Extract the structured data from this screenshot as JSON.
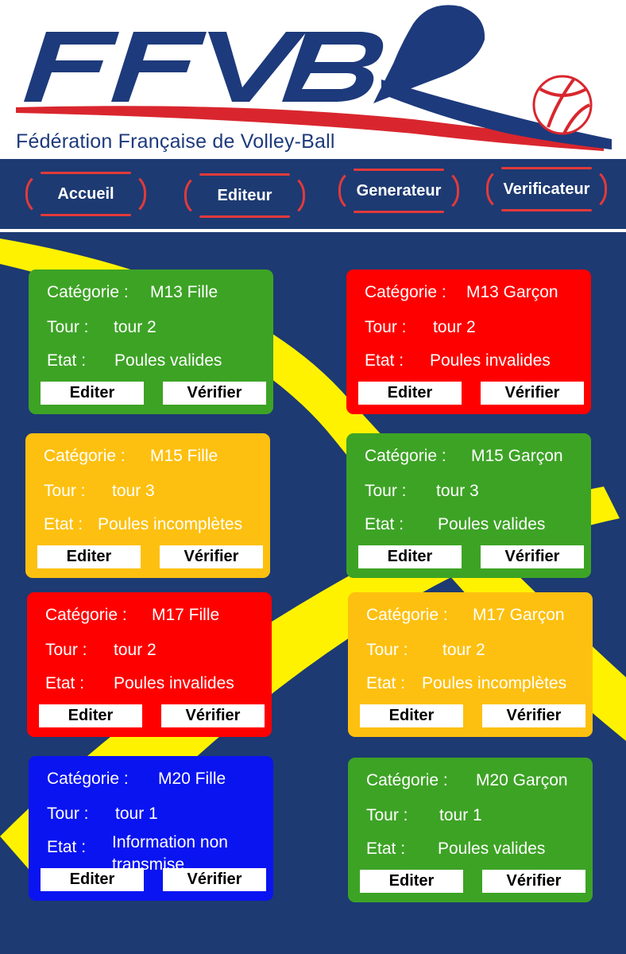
{
  "brand": {
    "logo_text": "FFVB",
    "federation_name": "Fédération Française de Volley-Ball",
    "colors": {
      "navy": "#1d3a7c",
      "red": "#d9262e",
      "white": "#ffffff"
    }
  },
  "nav": {
    "items": [
      {
        "label": "Accueil"
      },
      {
        "label": "Editeur"
      },
      {
        "label": "Generateur"
      },
      {
        "label": "Verificateur"
      }
    ],
    "border_color": "#e23a3a",
    "background": "#1d3a72"
  },
  "labels": {
    "categorie": "Catégorie :",
    "tour": "Tour :",
    "etat": "Etat :",
    "edit": "Editer",
    "verify": "Vérifier"
  },
  "status_colors": {
    "Poules valides": "#3da325",
    "Poules invalides": "#ff0000",
    "Poules incomplètes": "#fdc010",
    "Information non transmise": "#0a14f0"
  },
  "cards": [
    {
      "categorie": "M13 Fille",
      "tour": "tour 2",
      "etat": "Poules valides"
    },
    {
      "categorie": "M13 Garçon",
      "tour": "tour 2",
      "etat": "Poules invalides"
    },
    {
      "categorie": "M15 Fille",
      "tour": "tour 3",
      "etat": "Poules incomplètes"
    },
    {
      "categorie": "M15 Garçon",
      "tour": "tour 3",
      "etat": "Poules valides"
    },
    {
      "categorie": "M17 Fille",
      "tour": "tour 2",
      "etat": "Poules invalides"
    },
    {
      "categorie": "M17 Garçon",
      "tour": "tour 2",
      "etat": "Poules incomplètes"
    },
    {
      "categorie": "M20 Fille",
      "tour": "tour 1",
      "etat": "Information non transmise"
    },
    {
      "categorie": "M20 Garçon",
      "tour": "tour 1",
      "etat": "Poules valides"
    }
  ]
}
